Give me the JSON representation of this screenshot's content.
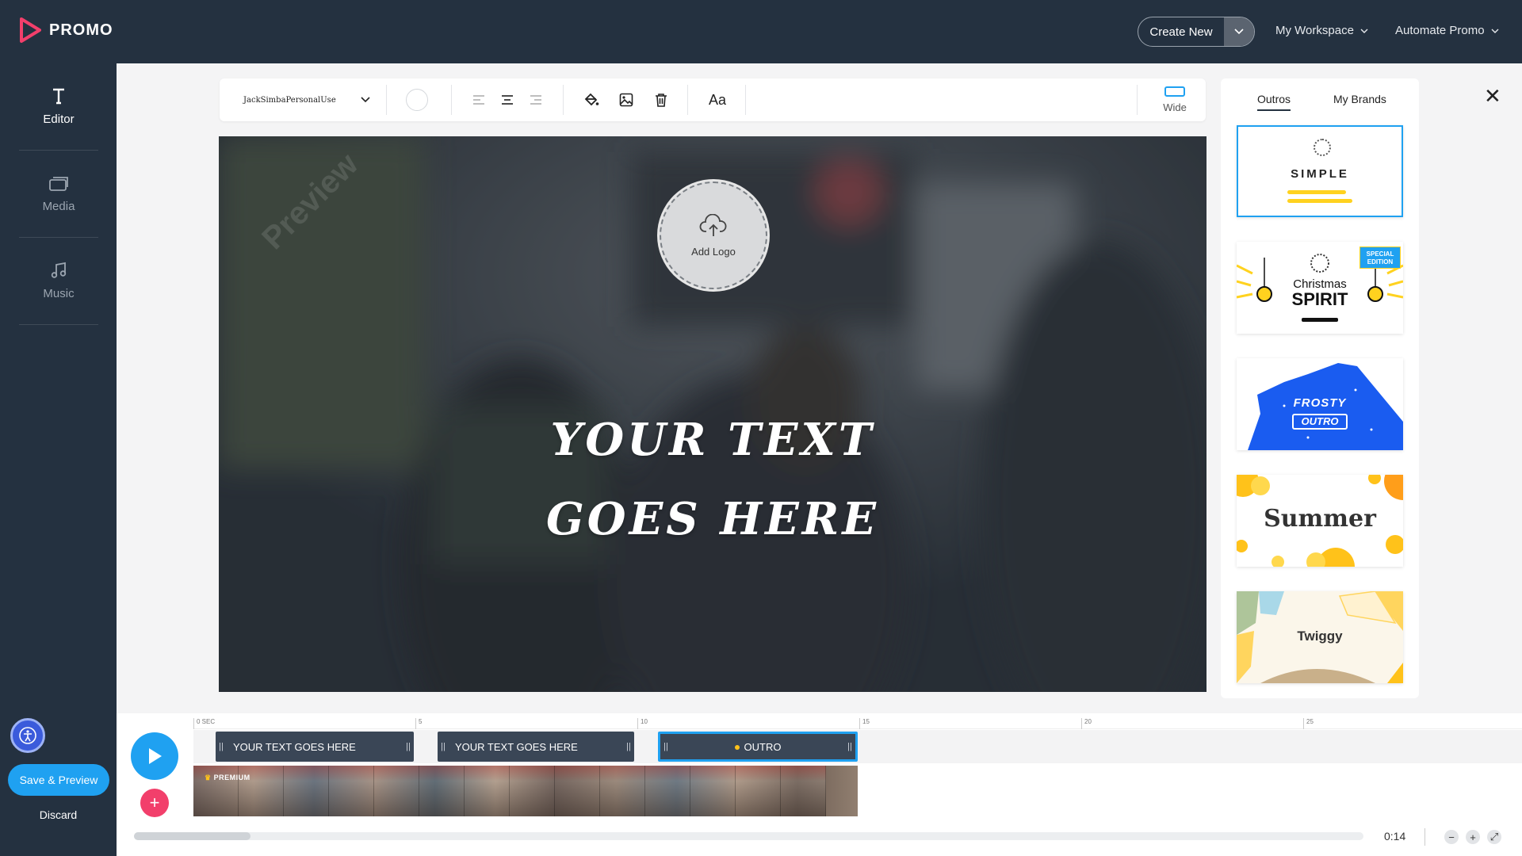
{
  "brand": {
    "name": "PROMO",
    "accent": "#f23f6b"
  },
  "header": {
    "create_new": "Create New",
    "my_workspace": "My Workspace",
    "automate_promo": "Automate Promo"
  },
  "sidebar": {
    "items": [
      {
        "label": "Editor",
        "icon": "text-icon"
      },
      {
        "label": "Media",
        "icon": "media-icon"
      },
      {
        "label": "Music",
        "icon": "music-icon"
      }
    ],
    "save_preview": "Save & Preview",
    "discard": "Discard"
  },
  "toolbar": {
    "font": "JackSimbaPersonalUse",
    "text_size_label": "Aa",
    "aspect_label": "Wide"
  },
  "canvas": {
    "add_logo": "Add Logo",
    "watermark": "Preview",
    "text_line1": "YOUR TEXT",
    "text_line2": "GOES HERE"
  },
  "panel": {
    "tabs": [
      "Outros",
      "My Brands"
    ],
    "cards": [
      {
        "name": "SIMPLE"
      },
      {
        "name_line1": "Christmas",
        "name_line2": "SPIRIT",
        "badge": "SPECIAL EDITION"
      },
      {
        "name_line1": "FROSTY",
        "name_line2": "OUTRO"
      },
      {
        "name": "Summer"
      },
      {
        "name": "Twiggy"
      }
    ]
  },
  "timeline": {
    "ticks": [
      "0 SEC",
      "5",
      "10",
      "15",
      "20",
      "25"
    ],
    "clips": [
      "YOUR TEXT GOES HERE",
      "YOUR TEXT GOES HERE",
      "OUTRO"
    ],
    "premium_label": "PREMIUM",
    "time": "0:14",
    "scroll_fraction": 0.095
  }
}
